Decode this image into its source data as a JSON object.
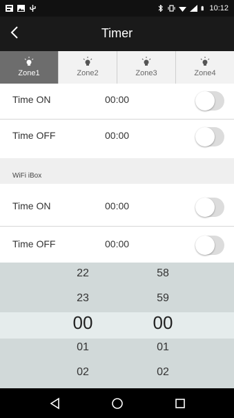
{
  "status_bar": {
    "time": "10:12",
    "icons": [
      "notification-icon",
      "image-icon",
      "usb-icon",
      "bluetooth-icon",
      "vibrate-icon",
      "wifi-icon",
      "signal-icon",
      "battery-icon"
    ]
  },
  "app_bar": {
    "title": "Timer",
    "back_icon": "back-arrow-icon"
  },
  "tabs": [
    {
      "label": "Zone1",
      "icon": "bulb-icon",
      "active": true
    },
    {
      "label": "Zone2",
      "icon": "bulb-icon",
      "active": false
    },
    {
      "label": "Zone3",
      "icon": "bulb-icon",
      "active": false
    },
    {
      "label": "Zone4",
      "icon": "bulb-icon",
      "active": false
    }
  ],
  "zone_rows": [
    {
      "label": "Time ON",
      "value": "00:00",
      "enabled": false
    },
    {
      "label": "Time OFF",
      "value": "00:00",
      "enabled": false
    }
  ],
  "wifi_section": {
    "label": "WiFi iBox"
  },
  "wifi_rows": [
    {
      "label": "Time ON",
      "value": "00:00",
      "enabled": false
    },
    {
      "label": "Time OFF",
      "value": "00:00",
      "enabled": false
    }
  ],
  "picker": {
    "hours": [
      "22",
      "23",
      "00",
      "01",
      "02"
    ],
    "minutes": [
      "58",
      "59",
      "00",
      "01",
      "02"
    ],
    "selected_hour": "00",
    "selected_minute": "00"
  },
  "nav_bar": {
    "icons": [
      "back-triangle-icon",
      "home-circle-icon",
      "recents-square-icon"
    ]
  },
  "colors": {
    "app_bar": "#1a1a1a",
    "active_tab": "#6d6d6d",
    "picker_bg": "#dfe6e6",
    "toggle_off": "#dcdcdc"
  }
}
